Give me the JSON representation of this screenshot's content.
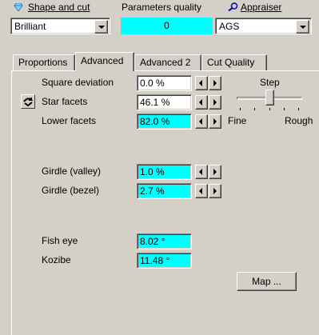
{
  "header": {
    "shape_label": "Shape and cut",
    "shape_value": "Brilliant",
    "quality_label": "Parameters quality",
    "quality_value": "0",
    "appraiser_label": "Appraiser",
    "appraiser_value": "AGS"
  },
  "tabs": [
    {
      "label": "Proportions",
      "active": false
    },
    {
      "label": "Advanced",
      "active": true
    },
    {
      "label": "Advanced 2",
      "active": false
    },
    {
      "label": "Cut Quality",
      "active": false
    }
  ],
  "params": {
    "square_deviation": {
      "label": "Square deviation",
      "value": "0.0 %"
    },
    "star_facets": {
      "label": "Star facets",
      "value": "46.1 %"
    },
    "lower_facets": {
      "label": "Lower facets",
      "value": "82.0 %"
    },
    "girdle_valley": {
      "label": "Girdle (valley)",
      "value": "1.0 %"
    },
    "girdle_bezel": {
      "label": "Girdle (bezel)",
      "value": "2.7 %"
    },
    "fish_eye": {
      "label": "Fish eye",
      "value": "8.02 °"
    },
    "kozibe": {
      "label": "Kozibe",
      "value": "11.48 °"
    }
  },
  "step": {
    "label": "Step",
    "min_label": "Fine",
    "max_label": "Rough",
    "position": 0.5
  },
  "map_button": "Map ...",
  "colors": {
    "highlight": "#00ffff",
    "face": "#d4d0c8"
  },
  "icons": {
    "shape": "gem-icon",
    "appraiser": "magnifier-icon",
    "star_facets": "link-toggle-icon"
  }
}
